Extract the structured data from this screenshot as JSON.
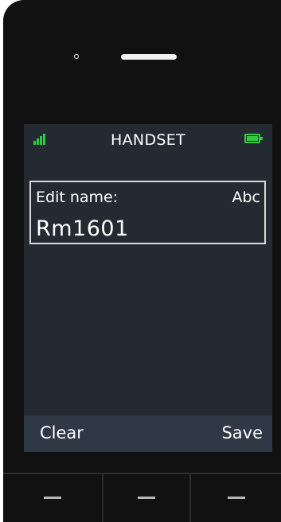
{
  "status_bar": {
    "title": "HANDSET",
    "signal_icon": "signal-bars-icon",
    "battery_icon": "battery-full-icon",
    "accent_color": "#2ecc40"
  },
  "editor": {
    "label": "Edit name:",
    "input_mode": "Abc",
    "value": "Rm1601"
  },
  "softkeys": {
    "left": "Clear",
    "right": "Save"
  },
  "hardware_keys": [
    {
      "icon": "left-softkey-dash-icon"
    },
    {
      "icon": "center-key-dash-icon"
    },
    {
      "icon": "right-softkey-dash-icon"
    }
  ]
}
